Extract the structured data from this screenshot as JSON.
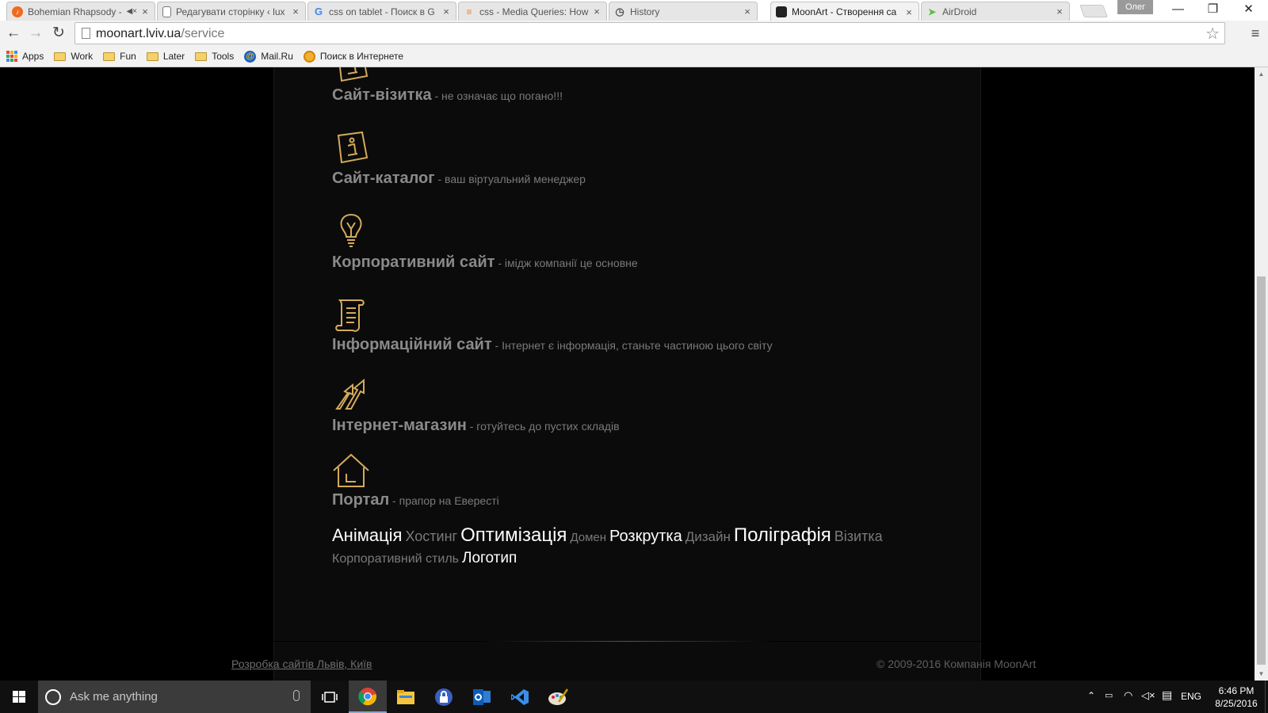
{
  "tabs": [
    {
      "title": "Bohemian Rhapsody -",
      "favicon": "music-icon",
      "muted": true
    },
    {
      "title": "Редагувати сторінку ‹ lux",
      "favicon": "page-icon"
    },
    {
      "title": "css on tablet - Поиск в G",
      "favicon": "google-icon"
    },
    {
      "title": "css - Media Queries: How",
      "favicon": "stackoverflow-icon"
    },
    {
      "title": "History",
      "favicon": "history-icon"
    },
    {
      "title": "MoonArt - Створення са",
      "favicon": "moonart-icon",
      "active": true
    },
    {
      "title": "AirDroid",
      "favicon": "airdroid-icon"
    }
  ],
  "profile_name": "Олег",
  "window_controls": {
    "minimize": "—",
    "restore": "❐",
    "close": "✕"
  },
  "address": {
    "domain": "moonart.lviv.ua",
    "path": "/service"
  },
  "bookmarks": [
    {
      "label": "Apps",
      "icon": "apps-grid-icon"
    },
    {
      "label": "Work",
      "icon": "folder-icon"
    },
    {
      "label": "Fun",
      "icon": "folder-icon"
    },
    {
      "label": "Later",
      "icon": "folder-icon"
    },
    {
      "label": "Tools",
      "icon": "folder-icon"
    },
    {
      "label": "Mail.Ru",
      "icon": "mailru-icon"
    },
    {
      "label": "Поиск в Интернете",
      "icon": "search-icon"
    }
  ],
  "services": [
    {
      "name": "Сайт-візитка",
      "desc": " - не означає що погано!!!",
      "icon": "info-card-icon"
    },
    {
      "name": "Сайт-каталог",
      "desc": " - ваш віртуальний менеджер",
      "icon": "info-card-icon"
    },
    {
      "name": "Корпоративний сайт",
      "desc": " - імідж компанії це основне",
      "icon": "lightbulb-icon"
    },
    {
      "name": "Інформаційний сайт",
      "desc": " - Інтернет є інформація, станьте частиною цього світу",
      "icon": "scroll-icon"
    },
    {
      "name": "Інтернет-магазин",
      "desc": " - готуйтесь до пустих складів",
      "icon": "arrows-up-icon"
    },
    {
      "name": "Портал",
      "desc": " - прапор на Евересті",
      "icon": "house-icon"
    }
  ],
  "tags": [
    {
      "label": "Анімація",
      "highlight": true,
      "size": 22
    },
    {
      "label": "Хостинг",
      "highlight": false,
      "size": 18
    },
    {
      "label": "Оптимізація",
      "highlight": true,
      "size": 24
    },
    {
      "label": "Домен",
      "highlight": false,
      "size": 15
    },
    {
      "label": "Розкрутка",
      "highlight": true,
      "size": 20
    },
    {
      "label": "Дизайн",
      "highlight": false,
      "size": 17
    },
    {
      "label": "Поліграфія",
      "highlight": true,
      "size": 24
    },
    {
      "label": "Візитка",
      "highlight": false,
      "size": 18
    },
    {
      "label": "Корпоративний стиль",
      "highlight": false,
      "size": 16
    },
    {
      "label": "Логотип",
      "highlight": true,
      "size": 19
    }
  ],
  "footer": {
    "link": "Розробка сайтів Львів, Київ",
    "copyright": "© 2009-2016 Компанія MoonArt"
  },
  "taskbar": {
    "search_placeholder": "Ask me anything",
    "apps": [
      "task-view-icon",
      "chrome-icon",
      "file-explorer-icon",
      "keepass-icon",
      "outlook-icon",
      "visual-studio-icon",
      "paint-icon"
    ],
    "language": "ENG",
    "time": "6:46 PM",
    "date": "8/25/2016"
  },
  "colors": {
    "accent_gold": "#d4aa5a",
    "page_bg": "#000000",
    "panel_bg": "#0b0b0b"
  }
}
